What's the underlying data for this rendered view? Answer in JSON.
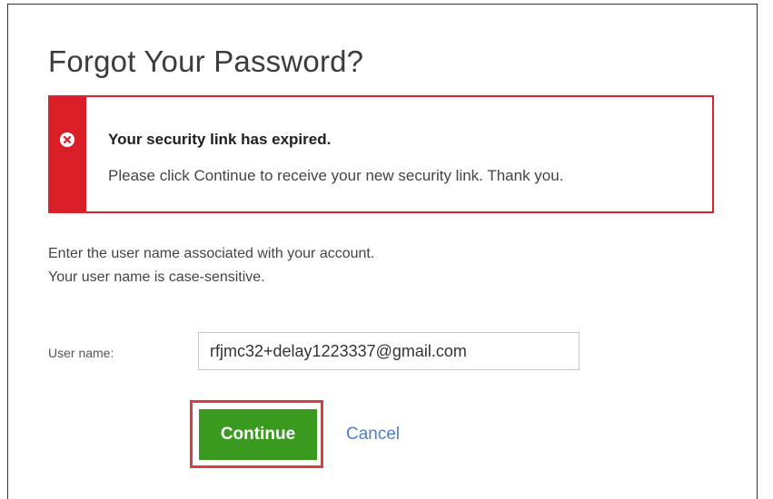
{
  "page": {
    "title": "Forgot Your Password?"
  },
  "alert": {
    "heading": "Your security link has expired.",
    "message": "Please click Continue to receive your new security link. Thank you.",
    "icon": "error-circle-icon",
    "color": "#da1e28"
  },
  "instructions": {
    "line1": "Enter the user name associated with your account.",
    "line2": "Your user name is case-sensitive."
  },
  "form": {
    "username_label": "User name:",
    "username_value": "rfjmc32+delay1223337@gmail.com"
  },
  "actions": {
    "continue_label": "Continue",
    "continue_color": "#3a9a1f",
    "cancel_label": "Cancel",
    "cancel_color": "#4a7fcb"
  }
}
